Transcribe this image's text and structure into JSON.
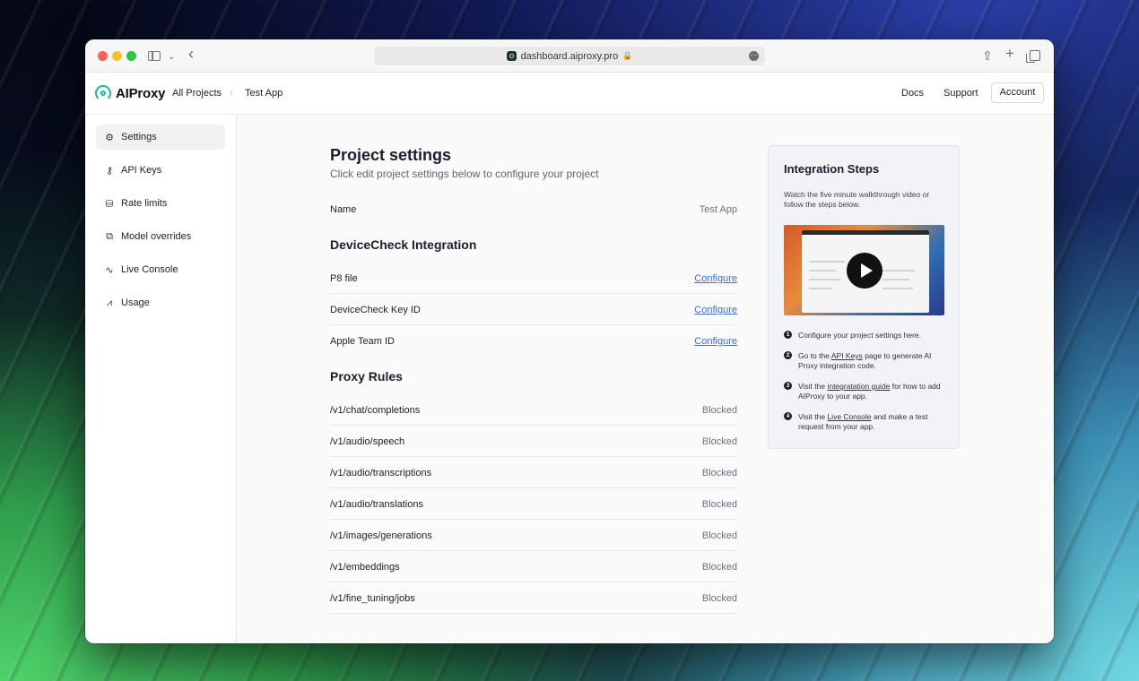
{
  "browser": {
    "url": "dashboard.aiproxy.pro"
  },
  "header": {
    "brand": "AIProxy",
    "breadcrumb": [
      "All Projects",
      "Test App"
    ],
    "breadcrumb_sep": "›",
    "links": {
      "docs": "Docs",
      "support": "Support",
      "account": "Account"
    }
  },
  "sidebar": {
    "items": [
      {
        "label": "Settings",
        "icon": "gear-icon",
        "active": true
      },
      {
        "label": "API Keys",
        "icon": "key-icon",
        "active": false
      },
      {
        "label": "Rate limits",
        "icon": "database-icon",
        "active": false
      },
      {
        "label": "Model overrides",
        "icon": "layers-icon",
        "active": false
      },
      {
        "label": "Live Console",
        "icon": "activity-icon",
        "active": false
      },
      {
        "label": "Usage",
        "icon": "chart-icon",
        "active": false
      }
    ]
  },
  "main": {
    "title": "Project settings",
    "subtitle": "Click edit project settings below to configure your project",
    "name": {
      "label": "Name",
      "value": "Test App"
    },
    "devicecheck": {
      "title": "DeviceCheck Integration",
      "rows": [
        {
          "label": "P8 file",
          "action": "Configure"
        },
        {
          "label": "DeviceCheck Key ID",
          "action": "Configure"
        },
        {
          "label": "Apple Team ID",
          "action": "Configure"
        }
      ]
    },
    "proxy_rules": {
      "title": "Proxy Rules",
      "rows": [
        {
          "label": "/v1/chat/completions",
          "status": "Blocked"
        },
        {
          "label": "/v1/audio/speech",
          "status": "Blocked"
        },
        {
          "label": "/v1/audio/transcriptions",
          "status": "Blocked"
        },
        {
          "label": "/v1/audio/translations",
          "status": "Blocked"
        },
        {
          "label": "/v1/images/generations",
          "status": "Blocked"
        },
        {
          "label": "/v1/embeddings",
          "status": "Blocked"
        },
        {
          "label": "/v1/fine_tuning/jobs",
          "status": "Blocked"
        }
      ]
    }
  },
  "integration": {
    "title": "Integration Steps",
    "description": "Watch the five minute walkthrough video or follow the steps below.",
    "steps": [
      {
        "num": "1",
        "pre": "Configure your project settings here.",
        "link": "",
        "post": ""
      },
      {
        "num": "2",
        "pre": "Go to the ",
        "link": "API Keys",
        "post": " page to generate AI Proxy integration code."
      },
      {
        "num": "3",
        "pre": "Visit the ",
        "link": "integratation guide",
        "post": " for how to add AIProxy to your app."
      },
      {
        "num": "4",
        "pre": "Visit the ",
        "link": "Live Console",
        "post": " and make a test request from your app."
      }
    ]
  },
  "colors": {
    "accent": "#1db3a3",
    "link": "#3b6fd6",
    "active_nav_bg": "#f1f2f4"
  }
}
